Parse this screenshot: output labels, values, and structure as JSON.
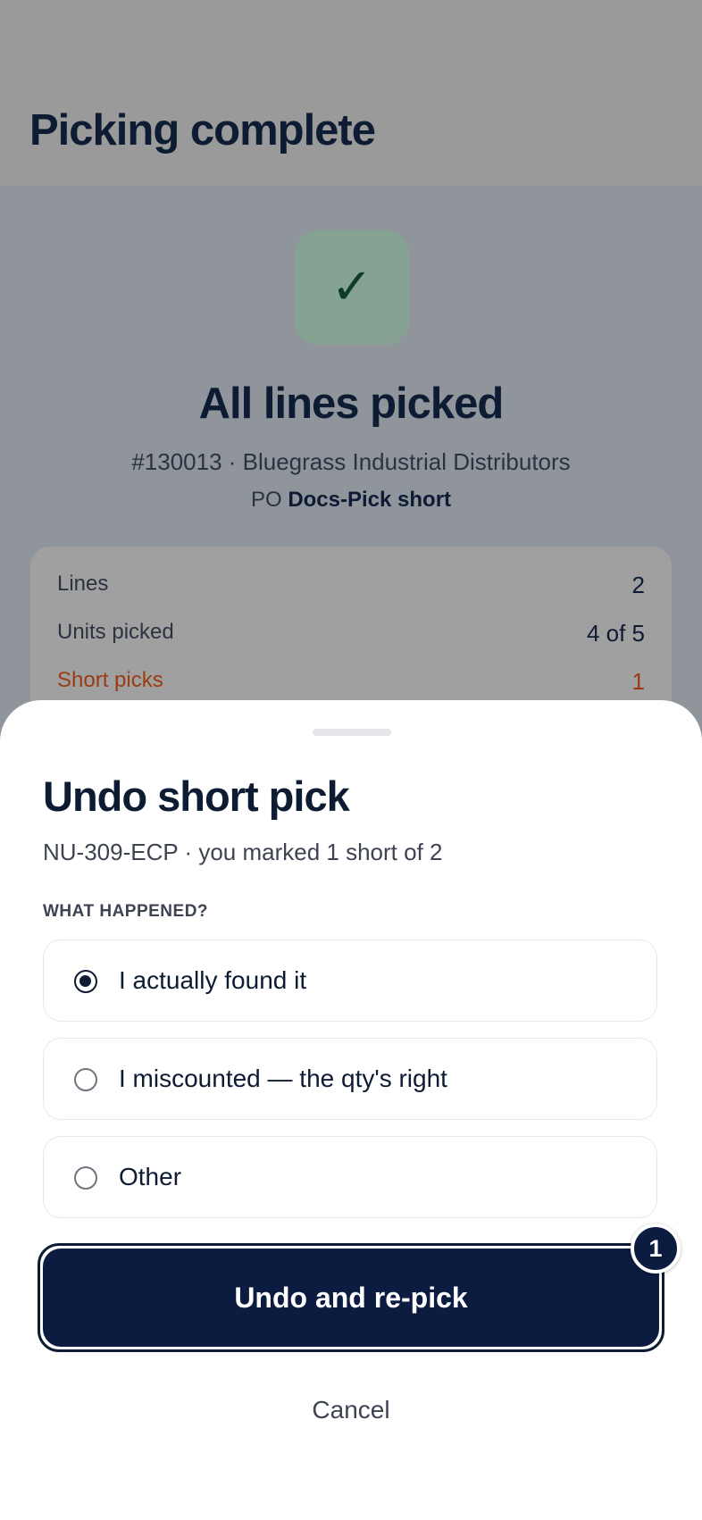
{
  "background": {
    "header": {
      "title": "Picking complete"
    },
    "status": {
      "icon": "check-icon",
      "icon_glyph": "✓",
      "title": "All lines picked",
      "order_line": "#130013 · Bluegrass Industrial Distributors",
      "po_prefix": "PO",
      "po_value": "Docs-Pick short"
    },
    "summary": {
      "rows": [
        {
          "label": "Lines",
          "value": "2"
        },
        {
          "label": "Units picked",
          "value": "4 of 5"
        },
        {
          "label": "Short picks",
          "value": "1"
        }
      ]
    }
  },
  "sheet": {
    "title": "Undo short pick",
    "subtitle": "NU-309-ECP · you marked 1 short of 2",
    "section_label": "WHAT HAPPENED?",
    "options": [
      {
        "label": "I actually found it",
        "selected": true
      },
      {
        "label": "I miscounted — the qty's right",
        "selected": false
      },
      {
        "label": "Other",
        "selected": false
      }
    ],
    "primary_button": {
      "label": "Undo and re-pick",
      "badge": "1"
    },
    "cancel_button": {
      "label": "Cancel"
    }
  },
  "colors": {
    "navy": "#0c1c40",
    "text_dark": "#0d1b33",
    "short_accent": "#9a3b12",
    "success_tile": "#86a293",
    "scrim": "#8f959b"
  }
}
